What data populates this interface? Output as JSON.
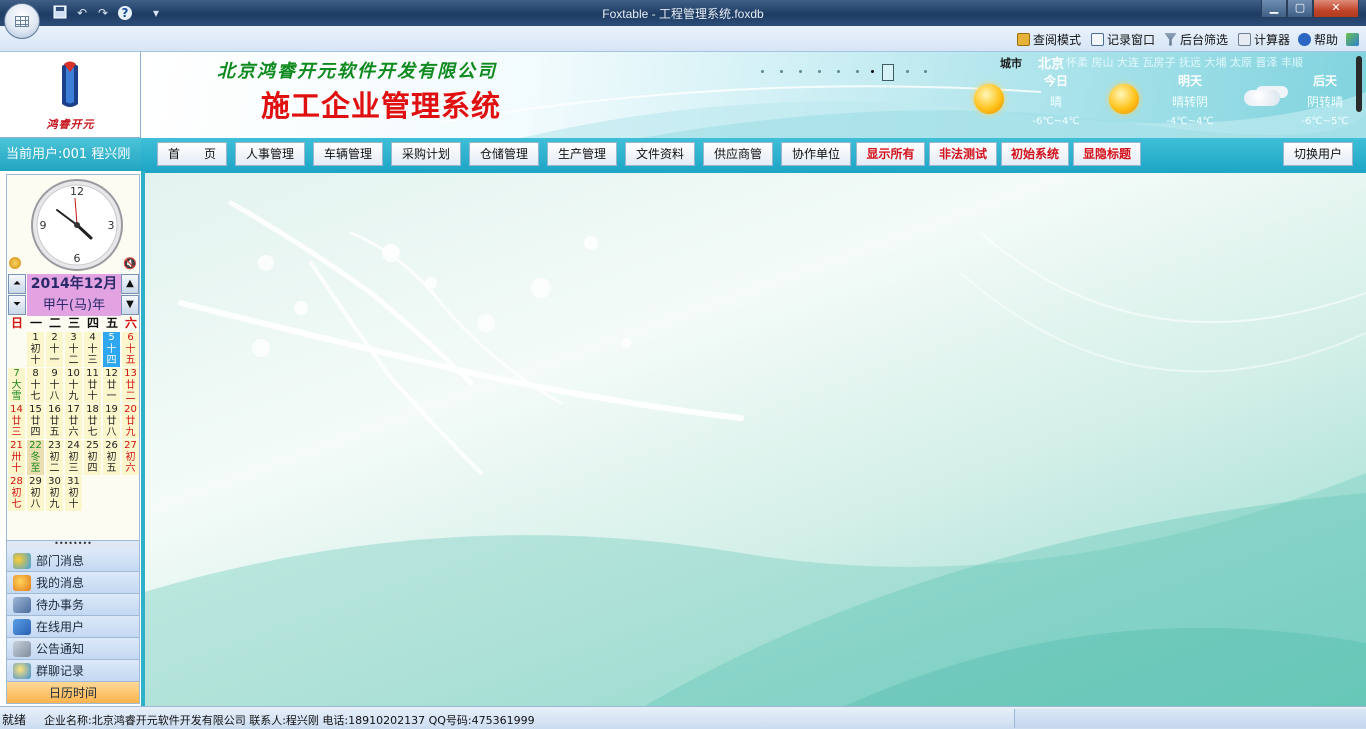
{
  "window": {
    "title": "Foxtable - 工程管理系统.foxdb",
    "min_glyph": "▁",
    "max_glyph": "▢",
    "close_glyph": "✕"
  },
  "quick_access": {
    "help_glyph": "?",
    "more_glyph": "▾"
  },
  "ribbon": {
    "items": [
      {
        "label": "查阅模式",
        "icon": "lock-icon"
      },
      {
        "label": "记录窗口",
        "icon": "record-window-icon"
      },
      {
        "label": "后台筛选",
        "icon": "filter-icon"
      },
      {
        "label": "计算器",
        "icon": "calculator-icon"
      },
      {
        "label": "帮助",
        "icon": "help-icon"
      }
    ]
  },
  "logo": {
    "text": "鸿睿开元"
  },
  "banner": {
    "company": "北京鸿睿开元软件开发有限公司",
    "system_title": "施工企业管理系统"
  },
  "weather": {
    "city_label": "城市",
    "current_city": "北京",
    "other_cities": "怀柔 房山 大连 瓦房子 抚远 大埔 太原 晋泽 丰顺",
    "days": [
      {
        "label": "今日",
        "desc": "晴",
        "temp": "-6℃~4℃",
        "icon": "sunny-icon"
      },
      {
        "label": "明天",
        "desc": "晴转阴",
        "temp": "-4℃~4℃",
        "icon": "sunny-icon"
      },
      {
        "label": "后天",
        "desc": "阴转晴",
        "temp": "-6℃~5℃",
        "icon": "cloudy-icon"
      }
    ]
  },
  "user": {
    "current": "当前用户:001 程兴刚"
  },
  "menu": {
    "items": [
      {
        "label": "首　　页",
        "style": "normal"
      },
      {
        "label": "人事管理",
        "style": "normal"
      },
      {
        "label": "车辆管理",
        "style": "normal"
      },
      {
        "label": "采购计划",
        "style": "normal"
      },
      {
        "label": "仓储管理",
        "style": "normal"
      },
      {
        "label": "生产管理",
        "style": "normal"
      },
      {
        "label": "文件资料",
        "style": "normal"
      },
      {
        "label": "供应商管",
        "style": "normal"
      },
      {
        "label": "协作单位",
        "style": "normal"
      },
      {
        "label": "显示所有",
        "style": "red"
      },
      {
        "label": "非法测试",
        "style": "red"
      },
      {
        "label": "初始系统",
        "style": "red"
      },
      {
        "label": "显隐标题",
        "style": "red"
      }
    ],
    "switch_user": "切换用户"
  },
  "calendar": {
    "year_month": "2014年12月",
    "ganzhi": "甲午(马)年",
    "weekdays": [
      "日",
      "一",
      "二",
      "三",
      "四",
      "五",
      "六"
    ],
    "nav": {
      "prev_year": "⏶",
      "next_year": "⏷",
      "prev_month": "▲",
      "next_month": "▼"
    },
    "weeks": [
      [
        null,
        {
          "d": "1",
          "l1": "初",
          "l2": "十"
        },
        {
          "d": "2",
          "l1": "十",
          "l2": "一"
        },
        {
          "d": "3",
          "l1": "十",
          "l2": "二"
        },
        {
          "d": "4",
          "l1": "十",
          "l2": "三"
        },
        {
          "d": "5",
          "l1": "十",
          "l2": "四",
          "today": true
        },
        {
          "d": "6",
          "l1": "十",
          "l2": "五"
        }
      ],
      [
        {
          "d": "7",
          "l1": "大",
          "l2": "雪",
          "term": true
        },
        {
          "d": "8",
          "l1": "十",
          "l2": "七"
        },
        {
          "d": "9",
          "l1": "十",
          "l2": "八"
        },
        {
          "d": "10",
          "l1": "十",
          "l2": "九"
        },
        {
          "d": "11",
          "l1": "廿",
          "l2": "十"
        },
        {
          "d": "12",
          "l1": "廿",
          "l2": "一"
        },
        {
          "d": "13",
          "l1": "廿",
          "l2": "二"
        }
      ],
      [
        {
          "d": "14",
          "l1": "廿",
          "l2": "三"
        },
        {
          "d": "15",
          "l1": "廿",
          "l2": "四"
        },
        {
          "d": "16",
          "l1": "廿",
          "l2": "五"
        },
        {
          "d": "17",
          "l1": "廿",
          "l2": "六"
        },
        {
          "d": "18",
          "l1": "廿",
          "l2": "七"
        },
        {
          "d": "19",
          "l1": "廿",
          "l2": "八"
        },
        {
          "d": "20",
          "l1": "廿",
          "l2": "九"
        }
      ],
      [
        {
          "d": "21",
          "l1": "卅",
          "l2": "十"
        },
        {
          "d": "22",
          "l1": "冬",
          "l2": "至",
          "term": true,
          "hol": true
        },
        {
          "d": "23",
          "l1": "初",
          "l2": "二"
        },
        {
          "d": "24",
          "l1": "初",
          "l2": "三"
        },
        {
          "d": "25",
          "l1": "初",
          "l2": "四"
        },
        {
          "d": "26",
          "l1": "初",
          "l2": "五"
        },
        {
          "d": "27",
          "l1": "初",
          "l2": "六"
        }
      ],
      [
        {
          "d": "28",
          "l1": "初",
          "l2": "七"
        },
        {
          "d": "29",
          "l1": "初",
          "l2": "八"
        },
        {
          "d": "30",
          "l1": "初",
          "l2": "九"
        },
        {
          "d": "31",
          "l1": "初",
          "l2": "十"
        },
        null,
        null,
        null
      ]
    ]
  },
  "sidebar_nav": {
    "separator": "••••••••",
    "items": [
      {
        "label": "部门消息",
        "icon": "department-message-icon"
      },
      {
        "label": "我的消息",
        "icon": "my-message-icon"
      },
      {
        "label": "待办事务",
        "icon": "todo-icon"
      },
      {
        "label": "在线用户",
        "icon": "online-users-icon"
      },
      {
        "label": "公告通知",
        "icon": "announcement-icon"
      },
      {
        "label": "群聊记录",
        "icon": "group-chat-icon"
      },
      {
        "label": "日历时间",
        "icon": "",
        "active": true
      }
    ]
  },
  "status": {
    "ready": "就绪",
    "info": "企业名称:北京鸿睿开元软件开发有限公司  联系人:程兴刚 电话:18910202137 QQ号码:475361999"
  }
}
